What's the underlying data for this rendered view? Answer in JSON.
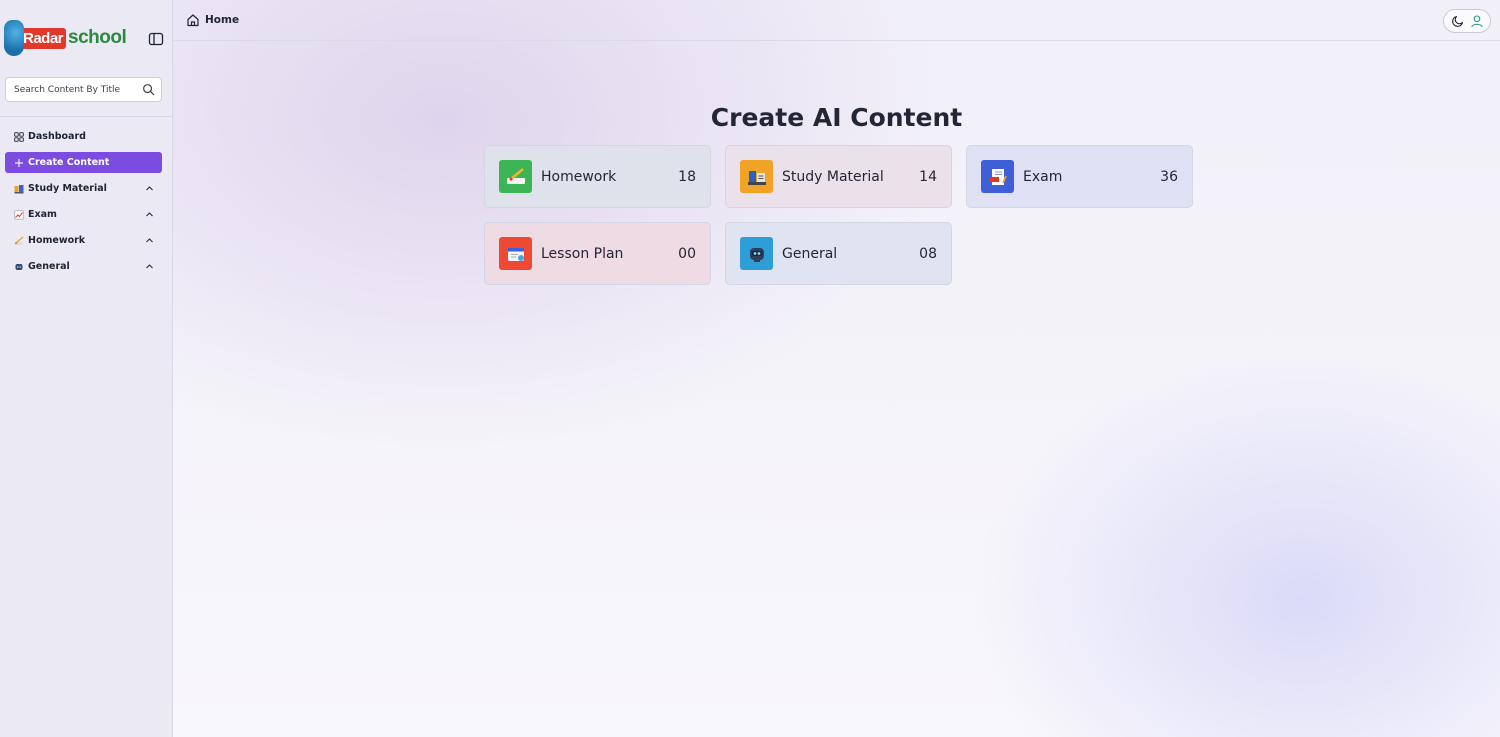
{
  "brand": {
    "part1": "Radar",
    "part2": "school"
  },
  "search": {
    "placeholder": "Search Content By Title"
  },
  "sidebar": {
    "items": [
      {
        "label": "Dashboard",
        "icon": "dashboard-grid-icon",
        "active": false,
        "expandable": false
      },
      {
        "label": "Create Content",
        "icon": "plus-icon",
        "active": true,
        "expandable": false
      },
      {
        "label": "Study Material",
        "icon": "study-material-icon",
        "active": false,
        "expandable": true
      },
      {
        "label": "Exam",
        "icon": "exam-icon",
        "active": false,
        "expandable": true
      },
      {
        "label": "Homework",
        "icon": "homework-icon",
        "active": false,
        "expandable": true
      },
      {
        "label": "General",
        "icon": "general-icon",
        "active": false,
        "expandable": true
      }
    ]
  },
  "header": {
    "breadcrumb": "Home"
  },
  "main": {
    "title": "Create AI Content",
    "cards": [
      {
        "label": "Homework",
        "count": "18",
        "color": "#3cb556",
        "bg": "#dfe2ea",
        "icon": "homework-icon"
      },
      {
        "label": "Study Material",
        "count": "14",
        "color": "#f1a325",
        "bg": "#ebe1ea",
        "icon": "study-material-icon"
      },
      {
        "label": "Exam",
        "count": "36",
        "color": "#3f5fd9",
        "bg": "#e0e1f5",
        "icon": "exam-icon"
      },
      {
        "label": "Lesson Plan",
        "count": "00",
        "color": "#ee4a33",
        "bg": "#efdbe4",
        "icon": "lesson-plan-icon"
      },
      {
        "label": "General",
        "count": "08",
        "color": "#2e9fd6",
        "bg": "#dfe3f2",
        "icon": "general-robot-icon"
      }
    ]
  },
  "colors": {
    "accent": "#7c4ce0",
    "sidebar_bg": "#eae9f4"
  }
}
